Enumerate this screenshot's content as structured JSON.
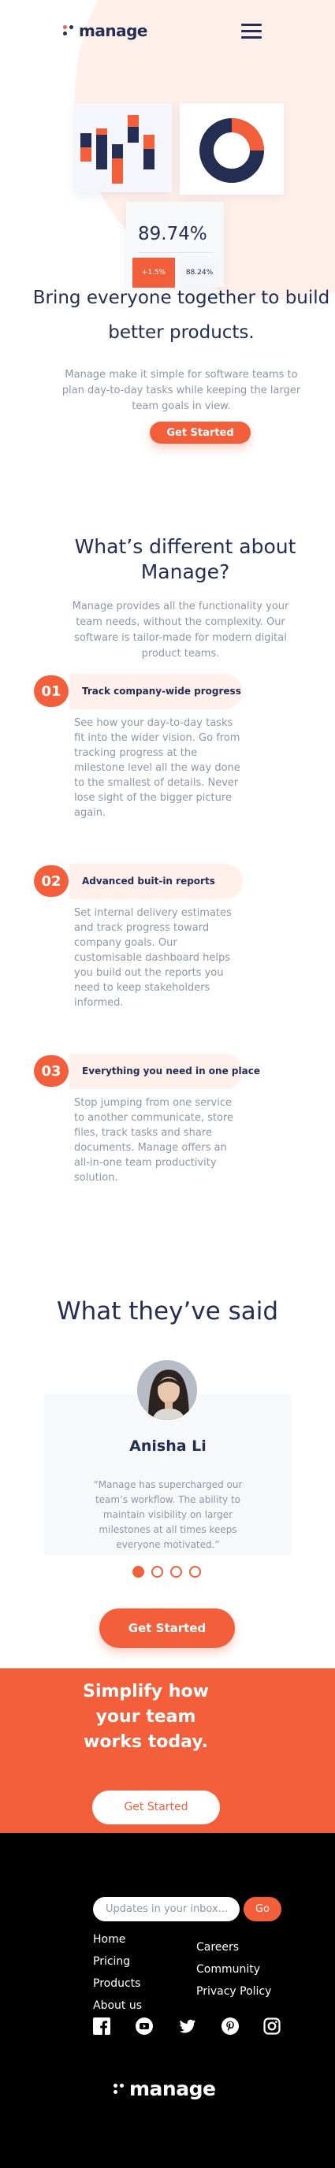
{
  "header": {
    "logo_text": "manage",
    "menu_icon": "hamburger-icon"
  },
  "hero": {
    "stat_value": "89.74%",
    "stat_change_up": "+1.5%",
    "stat_change_flat": "88.24%",
    "title": "Bring everyone together to build better products.",
    "text": "Manage make it simple for software teams to plan day-to-day tasks while keeping the larger team goals in view.",
    "cta_label": "Get Started"
  },
  "features": {
    "title": "What’s different about Manage?",
    "text": "Manage provides all the functionality your team needs, without the complexity. Our software is tailor-made for modern digital product teams.",
    "items": [
      {
        "number": "01",
        "title": "Track company-wide progress",
        "text": "See how your day-to-day tasks fit into the wider vision. Go from tracking progress at the milestone level all the way done to the smallest of details. Never lose sight of the bigger picture again."
      },
      {
        "number": "02",
        "title": "Advanced buit-in reports",
        "text": "Set internal delivery estimates and track progress toward company goals. Our customisable dashboard helps you build out the reports you need to keep stakeholders informed."
      },
      {
        "number": "03",
        "title": "Everything you need in one place",
        "text": "Stop jumping from one service to another communicate, store files, track tasks and share documents. Manage offers an all-in-one team productivity solution."
      }
    ]
  },
  "testimonials": {
    "title": "What they’ve said",
    "name": "Anisha Li",
    "quote": "“Manage has supercharged our team’s workflow. The ability to maintain visibility on larger milestones at all times keeps everyone motivated.”",
    "active_slide": 1,
    "slide_count": 4,
    "cta_label": "Get Started"
  },
  "cta": {
    "title": "Simplify how your team works today.",
    "button_label": "Get Started"
  },
  "footer": {
    "newsletter_placeholder": "Updates in your inbox...",
    "go_label": "Go",
    "links_left": [
      "Home",
      "Pricing",
      "Products",
      "About us"
    ],
    "links_right": [
      "Careers",
      "Community",
      "Privacy Policy"
    ],
    "socials": [
      "facebook-icon",
      "youtube-icon",
      "twitter-icon",
      "pinterest-icon",
      "instagram-icon"
    ],
    "logo_text": "manage"
  },
  "colors": {
    "brand_orange": "#F25F3A",
    "navy": "#242D52",
    "muted_text": "#9095A7",
    "pale_orange": "#FFF0EB",
    "footer_bg": "#000000"
  }
}
